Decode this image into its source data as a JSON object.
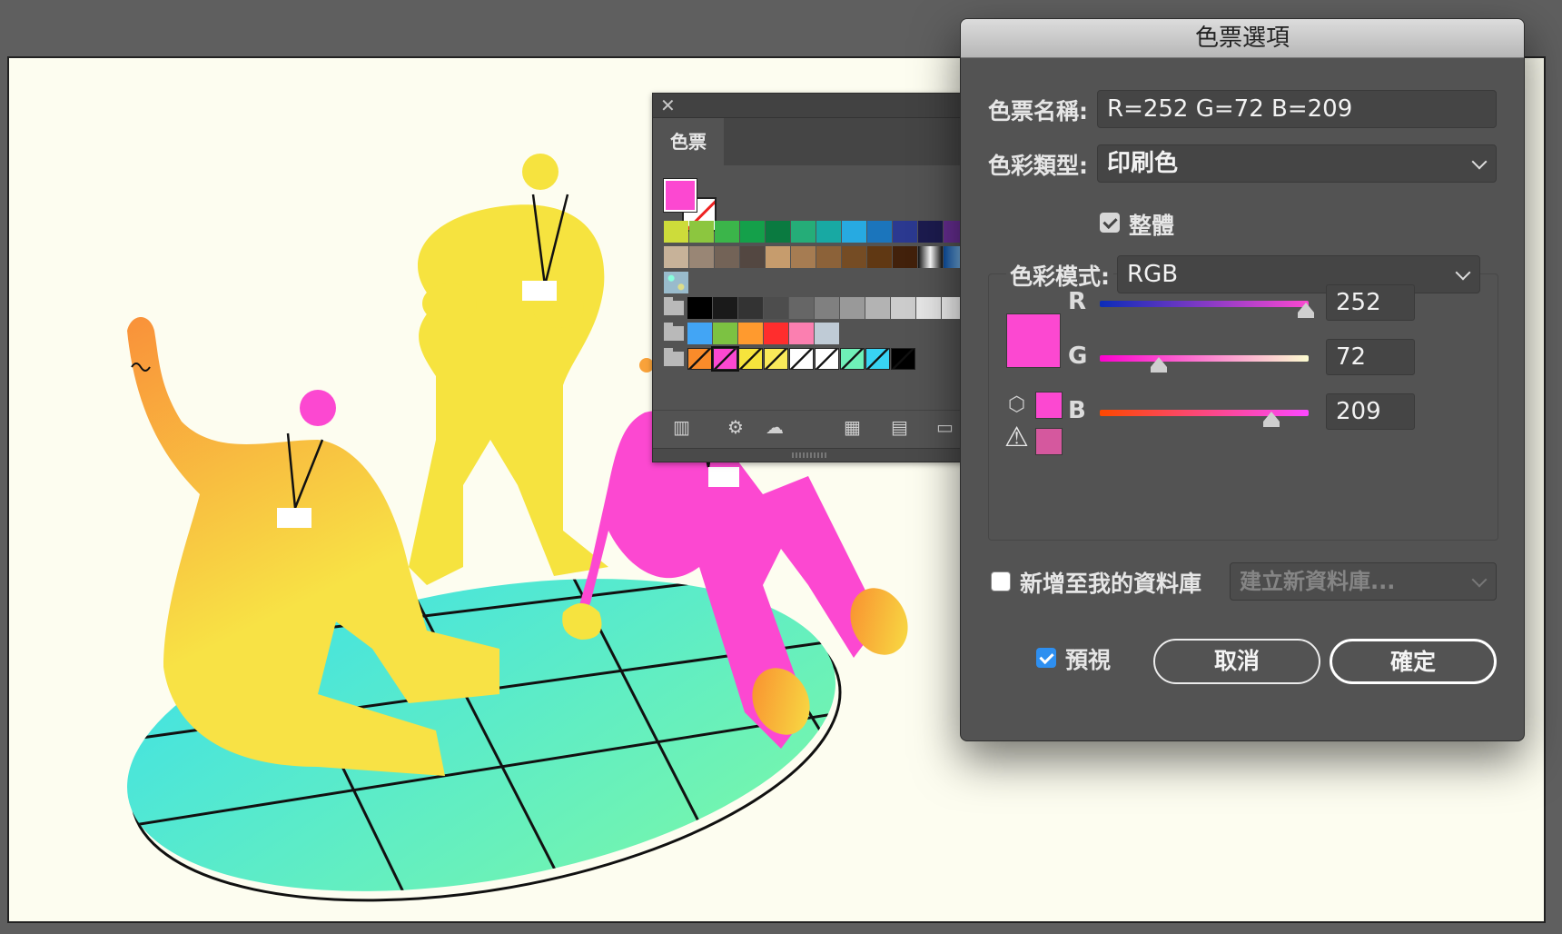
{
  "swatches_panel": {
    "close_glyph": "✕",
    "tab_label": "色票",
    "current_fill_color": "#fc48d1",
    "rows": [
      [
        "#cddc3a",
        "#8cc63f",
        "#3bb54a",
        "#14a04a",
        "#0a7a40",
        "#25ad78",
        "#18a9a3",
        "#27aae1",
        "#1b75bc",
        "#2b3990",
        "#1c1b4f",
        "#662d91"
      ],
      [
        "#c7b299",
        "#998675",
        "#736357",
        "#534741",
        "#c69c6d",
        "#a67c52",
        "#8c6239",
        "#754c24",
        "#603813",
        "#42210b",
        "#gradient-grey",
        "#gradient-blue"
      ],
      [
        "#pattern"
      ],
      [
        "#000000",
        "#1a1a1a",
        "#333333",
        "#4d4d4d",
        "#666666",
        "#808080",
        "#999999",
        "#b3b3b3",
        "#cccccc",
        "#e6e6e6",
        "#f2f2f2"
      ],
      [
        "#42a5f5",
        "#7cc242",
        "#ff9a2e",
        "#ff2d2d",
        "#fb7fb0",
        "#bfcbd6"
      ],
      [
        "#fa8b2a",
        "#fc48d1",
        "#f6e43c",
        "#f9e95a",
        "#ffffff",
        "#ffffff",
        "#6ff0b8",
        "#38d3f3",
        "#000000"
      ]
    ]
  },
  "dialog": {
    "title": "色票選項",
    "swatch_name_label": "色票名稱:",
    "swatch_name_value": "R=252 G=72 B=209",
    "color_type_label": "色彩類型:",
    "color_type_value": "印刷色",
    "global_label": "整體",
    "color_mode_label": "色彩模式:",
    "color_mode_value": "RGB",
    "preview_color": "#fc48d1",
    "gamut_color": "#d5589e",
    "sliders": [
      {
        "label": "R",
        "value": "252",
        "fraction": 0.988
      },
      {
        "label": "G",
        "value": "72",
        "fraction": 0.282
      },
      {
        "label": "B",
        "value": "209",
        "fraction": 0.82
      }
    ],
    "add_to_library_label": "新增至我的資料庫",
    "library_placeholder": "建立新資料庫...",
    "preview_label": "預視",
    "cancel_label": "取消",
    "ok_label": "確定"
  }
}
